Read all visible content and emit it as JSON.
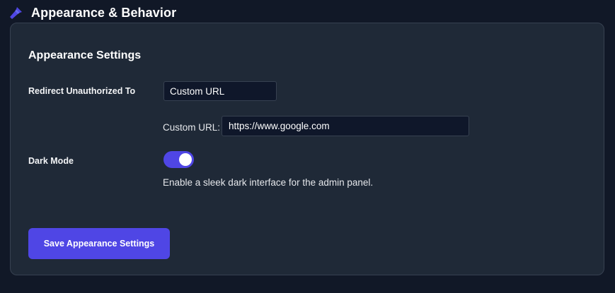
{
  "header": {
    "title": "Appearance & Behavior",
    "icon": "paint-brush-icon",
    "icon_color": "#4f46e5"
  },
  "section": {
    "title": "Appearance Settings"
  },
  "redirect": {
    "label": "Redirect Unauthorized To",
    "selected": "Custom URL",
    "custom_url_label": "Custom URL:",
    "custom_url_value": "https://www.google.com"
  },
  "dark_mode": {
    "label": "Dark Mode",
    "enabled": true,
    "description": "Enable a sleek dark interface for the admin panel."
  },
  "actions": {
    "save_label": "Save Appearance Settings"
  },
  "colors": {
    "background": "#111827",
    "card": "#1f2937",
    "accent": "#4f46e5",
    "input_bg": "#0f172a"
  }
}
